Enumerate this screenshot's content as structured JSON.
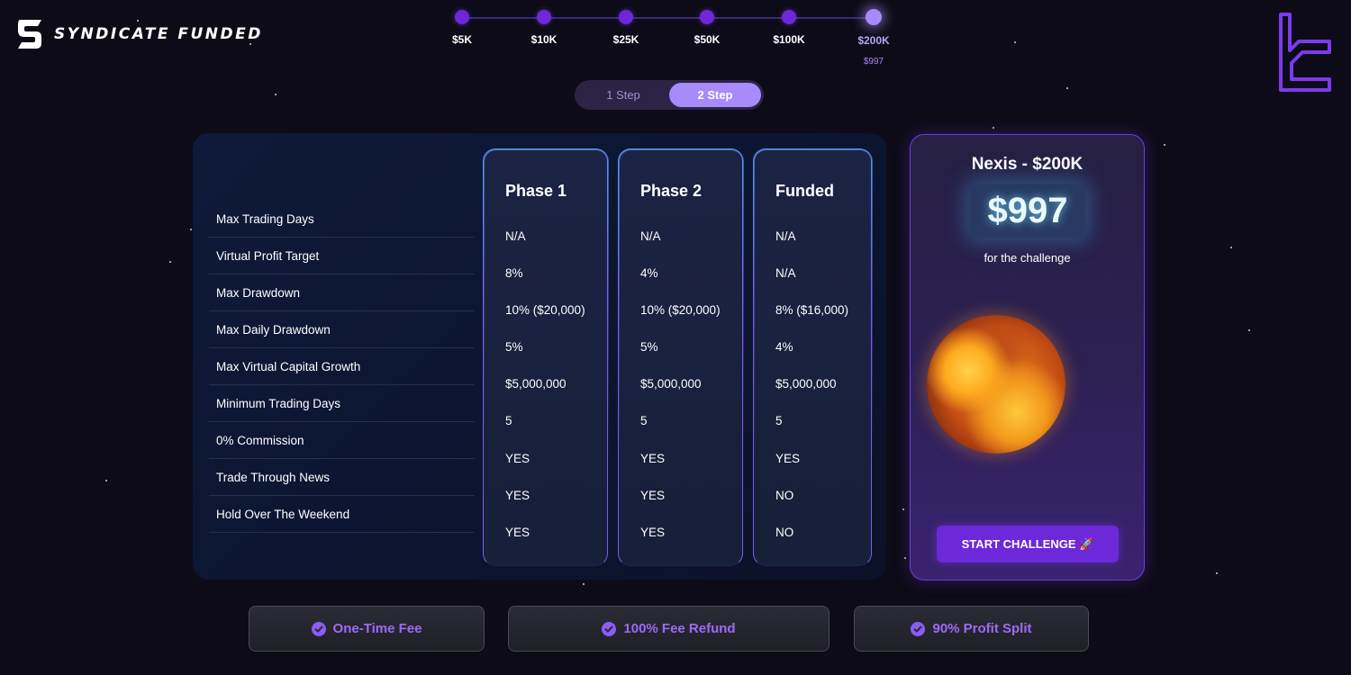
{
  "brand": {
    "name": "SYNDICATE FUNDED"
  },
  "account_sizes": [
    {
      "label": "$5K",
      "active": false
    },
    {
      "label": "$10K",
      "active": false
    },
    {
      "label": "$25K",
      "active": false
    },
    {
      "label": "$50K",
      "active": false
    },
    {
      "label": "$100K",
      "active": false
    },
    {
      "label": "$200K",
      "active": true,
      "price": "$997"
    }
  ],
  "phase_toggle": {
    "options": [
      "1 Step",
      "2 Step"
    ],
    "selected": "2 Step"
  },
  "rules": {
    "labels": [
      "Max Trading Days",
      "Virtual Profit Target",
      "Max Drawdown",
      "Max Daily Drawdown",
      "Max Virtual Capital Growth",
      "Minimum Trading Days",
      "0% Commission",
      "Trade Through News",
      "Hold Over The Weekend"
    ],
    "columns": [
      {
        "title": "Phase 1",
        "values": [
          "N/A",
          "8%",
          "10% ($20,000)",
          "5%",
          "$5,000,000",
          "5",
          "YES",
          "YES",
          "YES"
        ]
      },
      {
        "title": "Phase 2",
        "values": [
          "N/A",
          "4%",
          "10% ($20,000)",
          "5%",
          "$5,000,000",
          "5",
          "YES",
          "YES",
          "YES"
        ]
      },
      {
        "title": "Funded",
        "values": [
          "N/A",
          "N/A",
          "8% ($16,000)",
          "4%",
          "$5,000,000",
          "5",
          "YES",
          "NO",
          "NO"
        ]
      }
    ]
  },
  "offer": {
    "title": "Nexis - $200K",
    "price": "$997",
    "subtitle": "for the challenge",
    "button": "START CHALLENGE 🚀"
  },
  "features": [
    "One-Time Fee",
    "100% Fee Refund",
    "90% Profit Split"
  ],
  "colors": {
    "accent": "#6d28d9",
    "accent_light": "#a78bfa",
    "background": "#0d0b17"
  }
}
